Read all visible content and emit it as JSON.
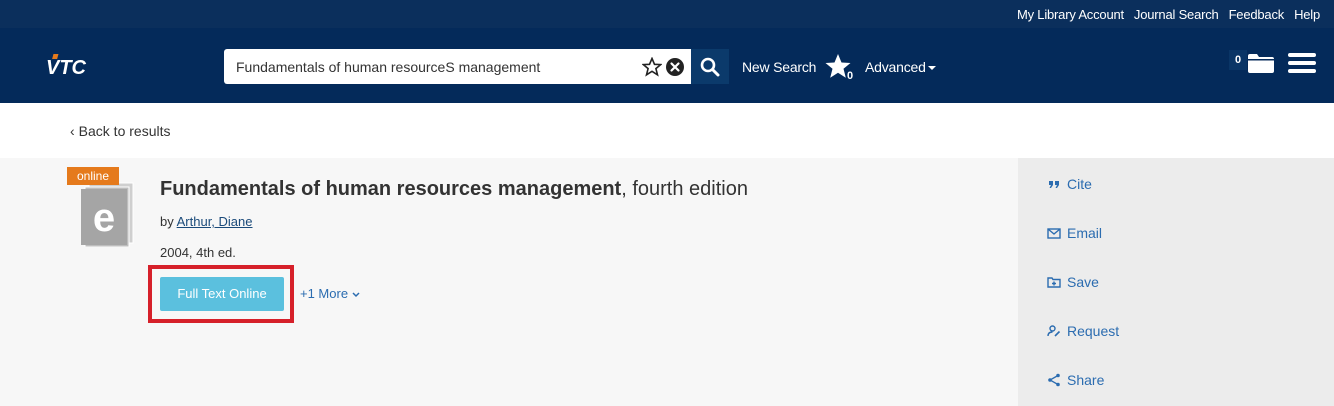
{
  "util_links": [
    "My Library Account",
    "Journal Search",
    "Feedback",
    "Help"
  ],
  "header": {
    "logo_text": "VTC",
    "search_value": "Fundamentals of human resourceS management",
    "new_search_label": "New Search",
    "pinned_count": "0",
    "advanced_label": "Advanced",
    "folder_count": "0"
  },
  "back_link": "Back to results",
  "record": {
    "badge": "online",
    "title_main": "Fundamentals of human resources management",
    "title_sub": ", fourth edition",
    "by_label": "by ",
    "author": "Arthur, Diane",
    "pub": "2004, 4th ed.",
    "fulltext_label": "Full Text Online",
    "more_label": "+1 More"
  },
  "sidebar": {
    "cite": "Cite",
    "email": "Email",
    "save": "Save",
    "request": "Request",
    "share": "Share"
  },
  "colors": {
    "header_bg": "#042a5a",
    "util_bg": "#0b2f5c",
    "accent_button": "#5bc0de",
    "badge": "#e57a1c",
    "highlight": "#d6202a",
    "link": "#2b6cb0"
  }
}
